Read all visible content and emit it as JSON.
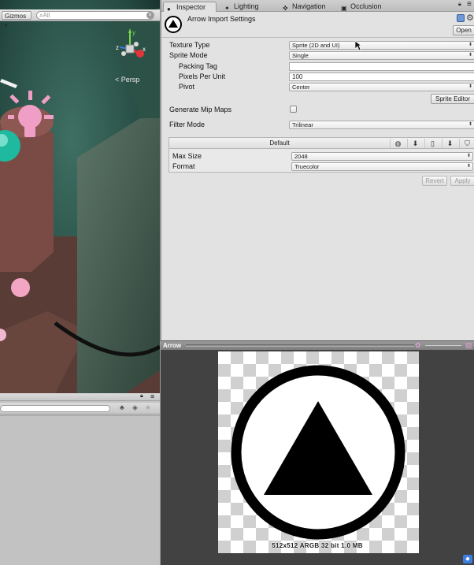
{
  "scene": {
    "gizmos_label": "Gizmos",
    "search_placeholder": "All",
    "persp_label": "Persp",
    "axis_x": "x",
    "axis_y": "y",
    "axis_z": "z"
  },
  "tabs": [
    {
      "label": "Inspector",
      "icon": "info-icon"
    },
    {
      "label": "Lighting",
      "icon": "lightbulb-icon"
    },
    {
      "label": "Navigation",
      "icon": "navigation-icon"
    },
    {
      "label": "Occlusion",
      "icon": "occlusion-icon"
    }
  ],
  "header": {
    "title": "Arrow Import Settings",
    "open_label": "Open"
  },
  "settings": {
    "texture_type_label": "Texture Type",
    "texture_type_value": "Sprite (2D and UI)",
    "sprite_mode_label": "Sprite Mode",
    "sprite_mode_value": "Single",
    "packing_tag_label": "Packing Tag",
    "packing_tag_value": "",
    "pixels_per_unit_label": "Pixels Per Unit",
    "pixels_per_unit_value": "100",
    "pivot_label": "Pivot",
    "pivot_value": "Center",
    "sprite_editor_label": "Sprite Editor",
    "mipmaps_label": "Generate Mip Maps",
    "mipmaps_checked": false,
    "filter_mode_label": "Filter Mode",
    "filter_mode_value": "Trilinear"
  },
  "platform": {
    "default_label": "Default",
    "icons": [
      "globe-icon",
      "download-icon",
      "phone-icon",
      "download-icon",
      "html5-icon"
    ],
    "max_size_label": "Max Size",
    "max_size_value": "2048",
    "format_label": "Format",
    "format_value": "Truecolor"
  },
  "actions": {
    "revert_label": "Revert",
    "apply_label": "Apply"
  },
  "preview": {
    "title": "Arrow",
    "info": "512x512  ARGB 32 bit   1.0 MB"
  }
}
